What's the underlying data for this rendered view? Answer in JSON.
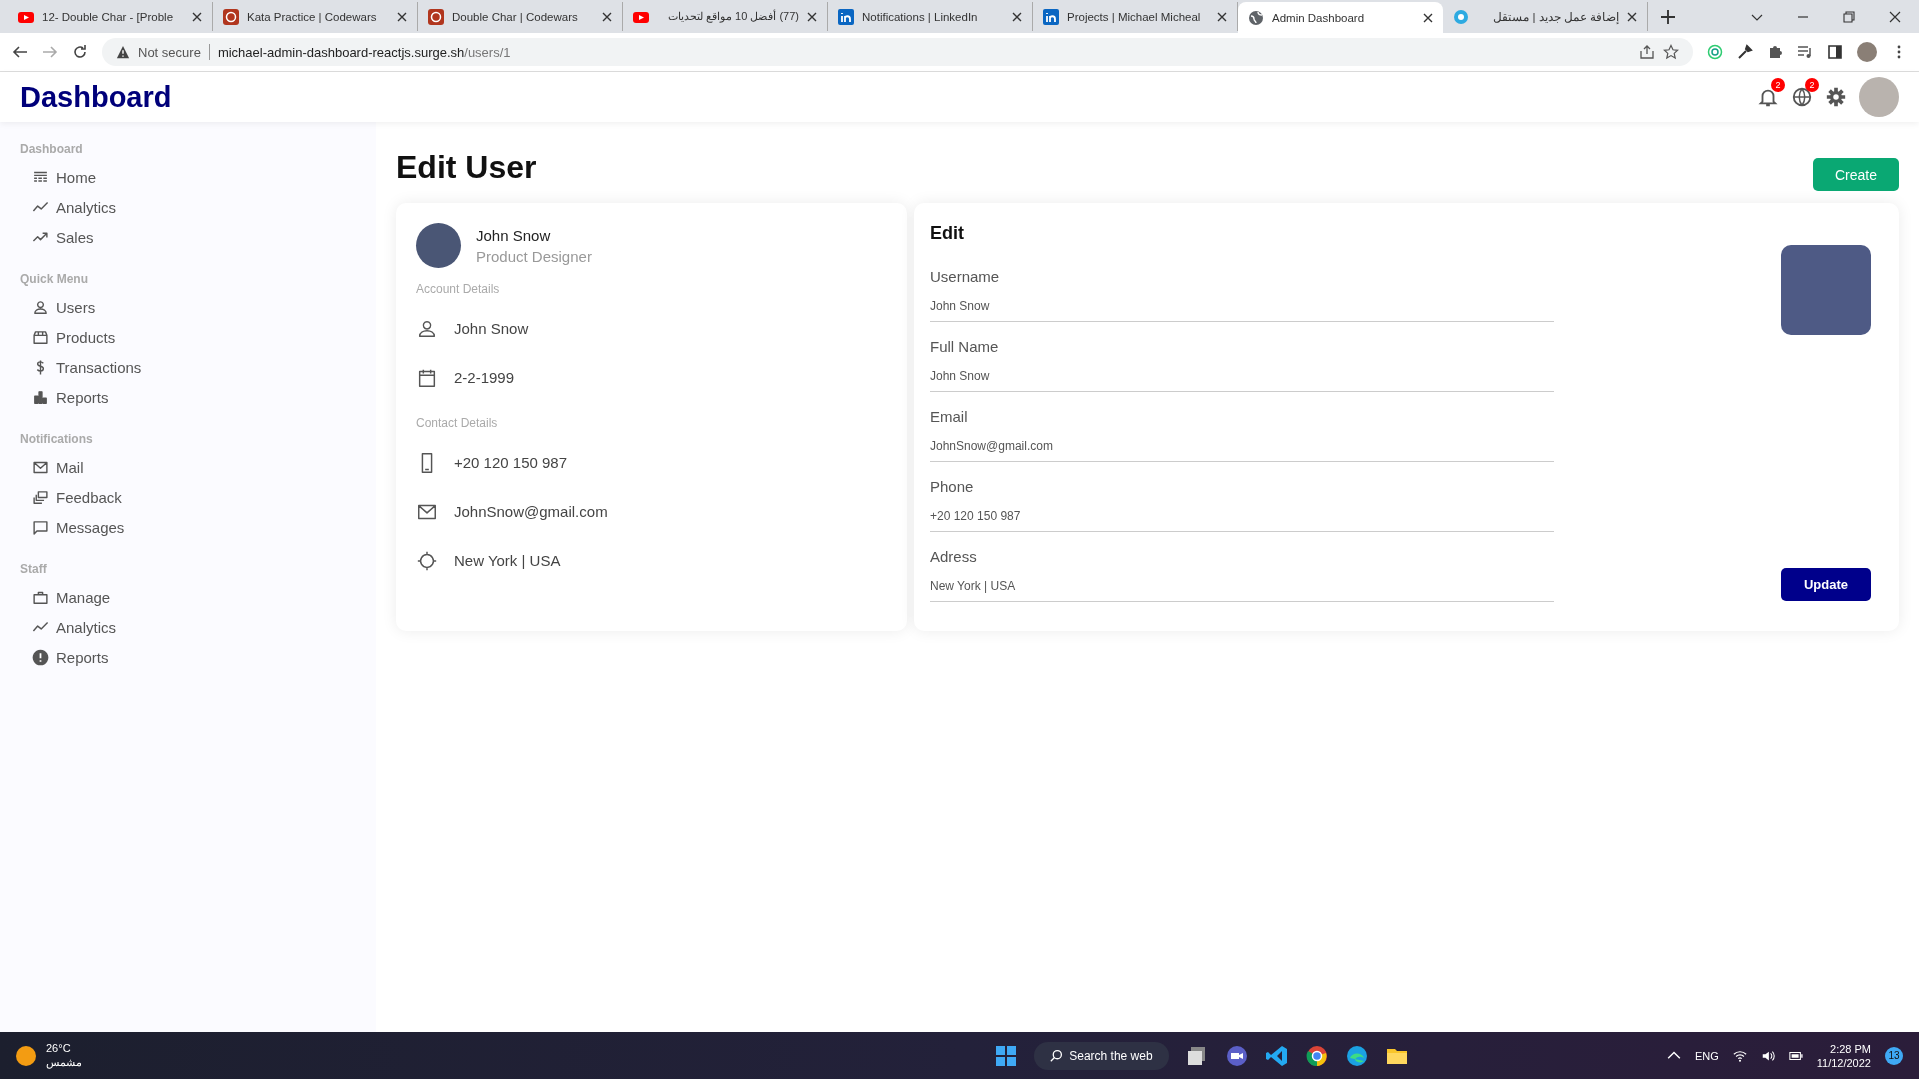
{
  "browser": {
    "tabs": [
      {
        "title": "12- Double Char - [Proble",
        "selected": false
      },
      {
        "title": "Kata Practice | Codewars",
        "selected": false
      },
      {
        "title": "Double Char | Codewars",
        "selected": false
      },
      {
        "title": "(77) أفضل 10 مواقع لتحديات",
        "selected": false
      },
      {
        "title": "Notifications | LinkedIn",
        "selected": false
      },
      {
        "title": "Projects | Michael Micheal",
        "selected": false
      },
      {
        "title": "Admin Dashboard",
        "selected": true
      },
      {
        "title": "إضافة عمل جديد | مستقل",
        "selected": false
      }
    ],
    "security": "Not secure",
    "url_host": "michael-admin-dashboard-reactjs.surge.sh",
    "url_path": "/users/1"
  },
  "header": {
    "logo": "Dashboard",
    "notifications_badge": "2",
    "language_badge": "2"
  },
  "sidebar": {
    "sections": [
      {
        "title": "Dashboard",
        "items": [
          "Home",
          "Analytics",
          "Sales"
        ]
      },
      {
        "title": "Quick Menu",
        "items": [
          "Users",
          "Products",
          "Transactions",
          "Reports"
        ]
      },
      {
        "title": "Notifications",
        "items": [
          "Mail",
          "Feedback",
          "Messages"
        ]
      },
      {
        "title": "Staff",
        "items": [
          "Manage",
          "Analytics",
          "Reports"
        ]
      }
    ]
  },
  "page": {
    "title": "Edit User",
    "create_button": "Create"
  },
  "profile_card": {
    "name": "John Snow",
    "role": "Product Designer",
    "sections": [
      {
        "title": "Account Details",
        "rows": [
          "John Snow",
          "2-2-1999"
        ]
      },
      {
        "title": "Contact Details",
        "rows": [
          "+20 120 150 987",
          "JohnSnow@gmail.com",
          "New York | USA"
        ]
      }
    ]
  },
  "edit_form": {
    "title": "Edit",
    "fields": [
      {
        "label": "Username",
        "value": "John Snow"
      },
      {
        "label": "Full Name",
        "value": "John Snow"
      },
      {
        "label": "Email",
        "value": "JohnSnow@gmail.com"
      },
      {
        "label": "Phone",
        "value": "+20 120 150 987"
      },
      {
        "label": "Adress",
        "value": "New York | USA"
      }
    ],
    "update_button": "Update"
  },
  "taskbar": {
    "temperature": "26°C",
    "weather": "مشمس",
    "search": "Search the web",
    "language": "ENG",
    "time": "2:28 PM",
    "date": "11/12/2022",
    "notification_count": "13"
  }
}
